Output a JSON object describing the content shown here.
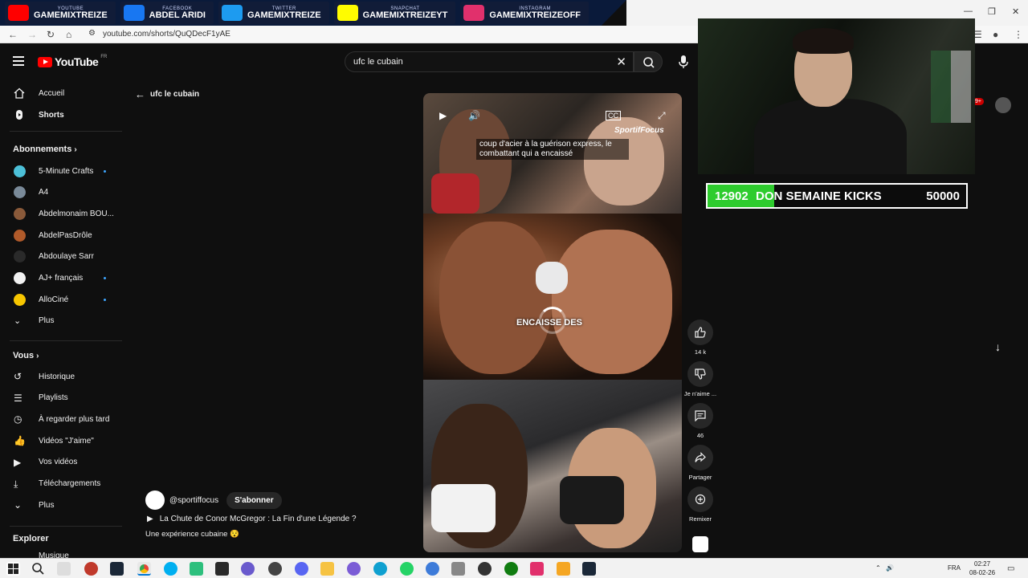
{
  "banner": {
    "items": [
      {
        "small": "YOUTUBE",
        "main": "GAMEMIXTREIZE",
        "icon": "youtube-icon",
        "color": "#ff0000"
      },
      {
        "small": "FACEBOOK",
        "main": "ABDEL ARIDI",
        "icon": "facebook-icon",
        "color": "#1877f2"
      },
      {
        "small": "TWITTER",
        "main": "GAMEMIXTREIZE",
        "icon": "twitter-icon",
        "color": "#1d9bf0"
      },
      {
        "small": "SNAPCHAT",
        "main": "GAMEMIXTREIZEYT",
        "icon": "snapchat-icon",
        "color": "#fffc00"
      },
      {
        "small": "INSTAGRAM",
        "main": "GAMEMIXTREIZEOFF",
        "icon": "instagram-icon",
        "color": "#e1306c"
      }
    ]
  },
  "browser": {
    "url": "youtube.com/shorts/QuQDecF1yAE"
  },
  "header": {
    "logo": "YouTube",
    "region": "FR",
    "search_value": "ufc le cubain",
    "notifications": "9+"
  },
  "sidebar": {
    "main": [
      {
        "label": "Accueil",
        "icon": "home-icon"
      },
      {
        "label": "Shorts",
        "icon": "shorts-icon"
      }
    ],
    "subs_heading": "Abonnements",
    "subs": [
      {
        "label": "5-Minute Crafts",
        "color": "#4cc0d8",
        "dot": true
      },
      {
        "label": "A4",
        "color": "#7a8a99",
        "dot": false
      },
      {
        "label": "Abdelmonaim BOU...",
        "color": "#8a5a3a",
        "dot": false
      },
      {
        "label": "AbdelPasDrôle",
        "color": "#b05a2a",
        "dot": false
      },
      {
        "label": "Abdoulaye Sarr",
        "color": "#2a2a2a",
        "dot": false
      },
      {
        "label": "AJ+ français",
        "color": "#f2f2f2",
        "dot": true
      },
      {
        "label": "AlloCiné",
        "color": "#f7c600",
        "dot": true
      },
      {
        "label": "Plus",
        "color": "",
        "dot": false
      }
    ],
    "you_heading": "Vous",
    "you": [
      {
        "label": "Historique",
        "icon": "history-icon"
      },
      {
        "label": "Playlists",
        "icon": "playlist-icon"
      },
      {
        "label": "À regarder plus tard",
        "icon": "clock-icon"
      },
      {
        "label": "Vidéos \"J'aime\"",
        "icon": "thumbs-up-icon"
      },
      {
        "label": "Vos vidéos",
        "icon": "video-icon"
      },
      {
        "label": "Téléchargements",
        "icon": "download-icon"
      },
      {
        "label": "Plus",
        "icon": "chevron-down-icon"
      }
    ],
    "explore_heading": "Explorer",
    "explore_first": "Musique"
  },
  "shorts": {
    "back_label": "ufc le cubain",
    "caption": "coup d'acier à la guérison express, le combattant qui a encaissé",
    "brand": "SportifFocus",
    "overlay": "ENCAISSE DES",
    "channel": "@sportiffocus",
    "subscribe": "S'abonner",
    "title": "La Chute de Conor McGregor : La Fin d'une Légende ?",
    "description": "Une expérience cubaine 😯"
  },
  "actions": {
    "like_count": "14 k",
    "dislike_label": "Je n'aime ...",
    "comments_count": "46",
    "share_label": "Partager",
    "remix_label": "Remixer"
  },
  "goal": {
    "current": "12902",
    "label": "DON SEMAINE KICKS",
    "target": "50000",
    "progress": 0.258,
    "fill_color": "#2ecc2e"
  },
  "taskbar": {
    "lang": "FRA",
    "time": "02:27",
    "date": "08-02-26"
  }
}
